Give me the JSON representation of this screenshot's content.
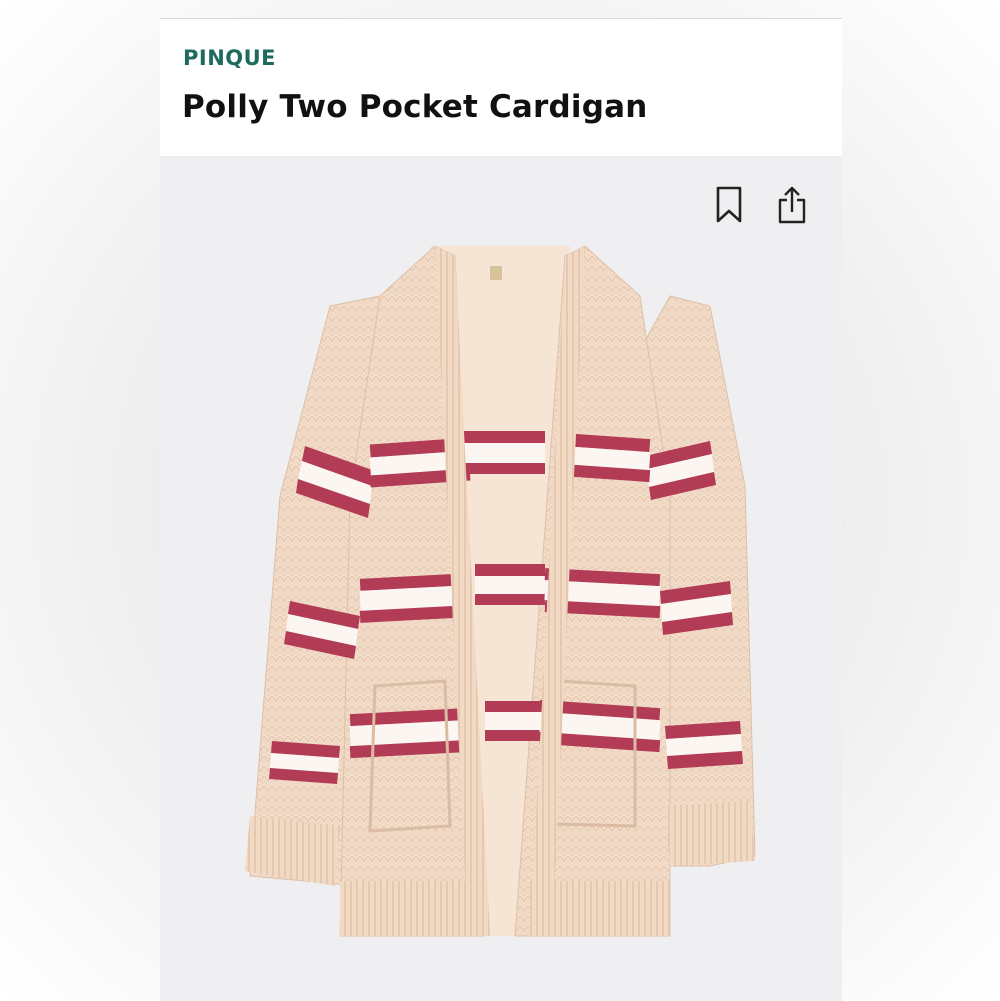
{
  "header": {
    "brand": "PINQUE",
    "title": "Polly Two Pocket Cardigan"
  },
  "actions": {
    "bookmark_icon": "bookmark-icon",
    "share_icon": "share-icon"
  },
  "image": {
    "subject": "striped-cardigan-photo",
    "colors": {
      "knit": "#f3dcc8",
      "stripe_red": "#b23b56",
      "stripe_white": "#fbf6f1",
      "background": "#efeff1"
    }
  },
  "theme": {
    "brand_color": "#1d6b5e",
    "title_color": "#111111"
  }
}
